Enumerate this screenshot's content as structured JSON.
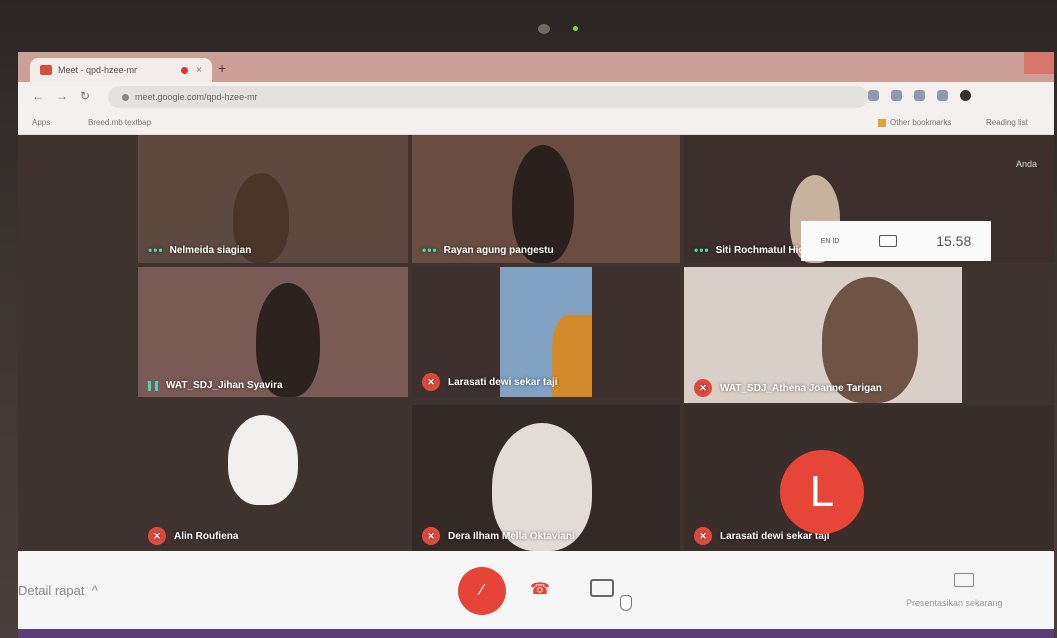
{
  "browser": {
    "tab_title": "Meet - qpd-hzee-mr",
    "tab_close": "×",
    "new_tab": "+",
    "url": "meet.google.com/qpd-hzee-mr",
    "bookmarks": {
      "apps": "Apps",
      "pinned": "Breed.mb textbap",
      "other": "Other bookmarks",
      "reading": "Reading list"
    }
  },
  "system": {
    "time": "15.58",
    "network_label": "EN ID"
  },
  "participants": [
    {
      "name": "Nelmeida siagian",
      "status": "speaking-dots"
    },
    {
      "name": "Rayan agung pangestu",
      "status": "speaking-dots"
    },
    {
      "name": "Siti Rochmatul Hidayah",
      "status": "speaking-dots"
    },
    {
      "name": "WAT_SDJ_Jihan Syavira",
      "status": "speaking"
    },
    {
      "name": "Larasati dewi sekar taji",
      "status": "muted"
    },
    {
      "name": "WAT_SDJ_Athena Joanne Tarigan",
      "status": "muted"
    },
    {
      "name": "Alin Roufiena",
      "status": "muted"
    },
    {
      "name": "Dera Ilham Mella Oktaviani",
      "status": "muted"
    },
    {
      "name": "Larasati dewi sekar taji",
      "status": "muted"
    }
  ],
  "avatar_initial": "L",
  "self_label": "Anda",
  "controls": {
    "meeting_details": "Detail rapat",
    "details_chevron": "^",
    "present_now": "Presentasikan sekarang"
  },
  "colors": {
    "accent_red": "#e64339",
    "speaking_green": "#55d6a8"
  }
}
